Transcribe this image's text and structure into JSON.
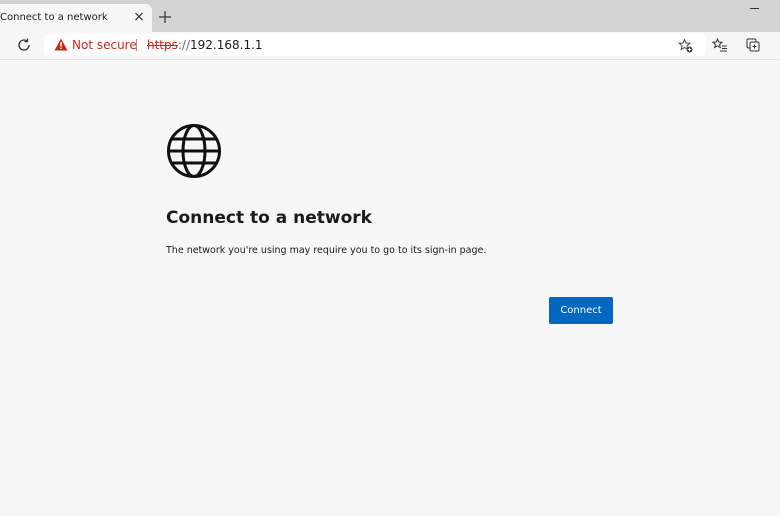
{
  "tab": {
    "title": "Connect to a network",
    "close_symbol": "×"
  },
  "address_bar": {
    "security_label": "Not secure",
    "url_scheme": "https",
    "url_separator": "://",
    "url_host": "192.168.1.1"
  },
  "page": {
    "heading": "Connect to a network",
    "description": "The network you're using may require you to go to its sign-in page.",
    "connect_label": "Connect"
  },
  "icons": {
    "security": "warning-triangle-icon",
    "refresh": "refresh-icon",
    "new_tab": "plus-icon",
    "add_favorite": "star-plus-icon",
    "favorites": "favorites-list-icon",
    "collections": "collections-icon",
    "hero": "globe-icon"
  },
  "colors": {
    "warning": "#c42b1c",
    "primary_button": "#0067c0",
    "page_background": "#f7f7f7"
  }
}
